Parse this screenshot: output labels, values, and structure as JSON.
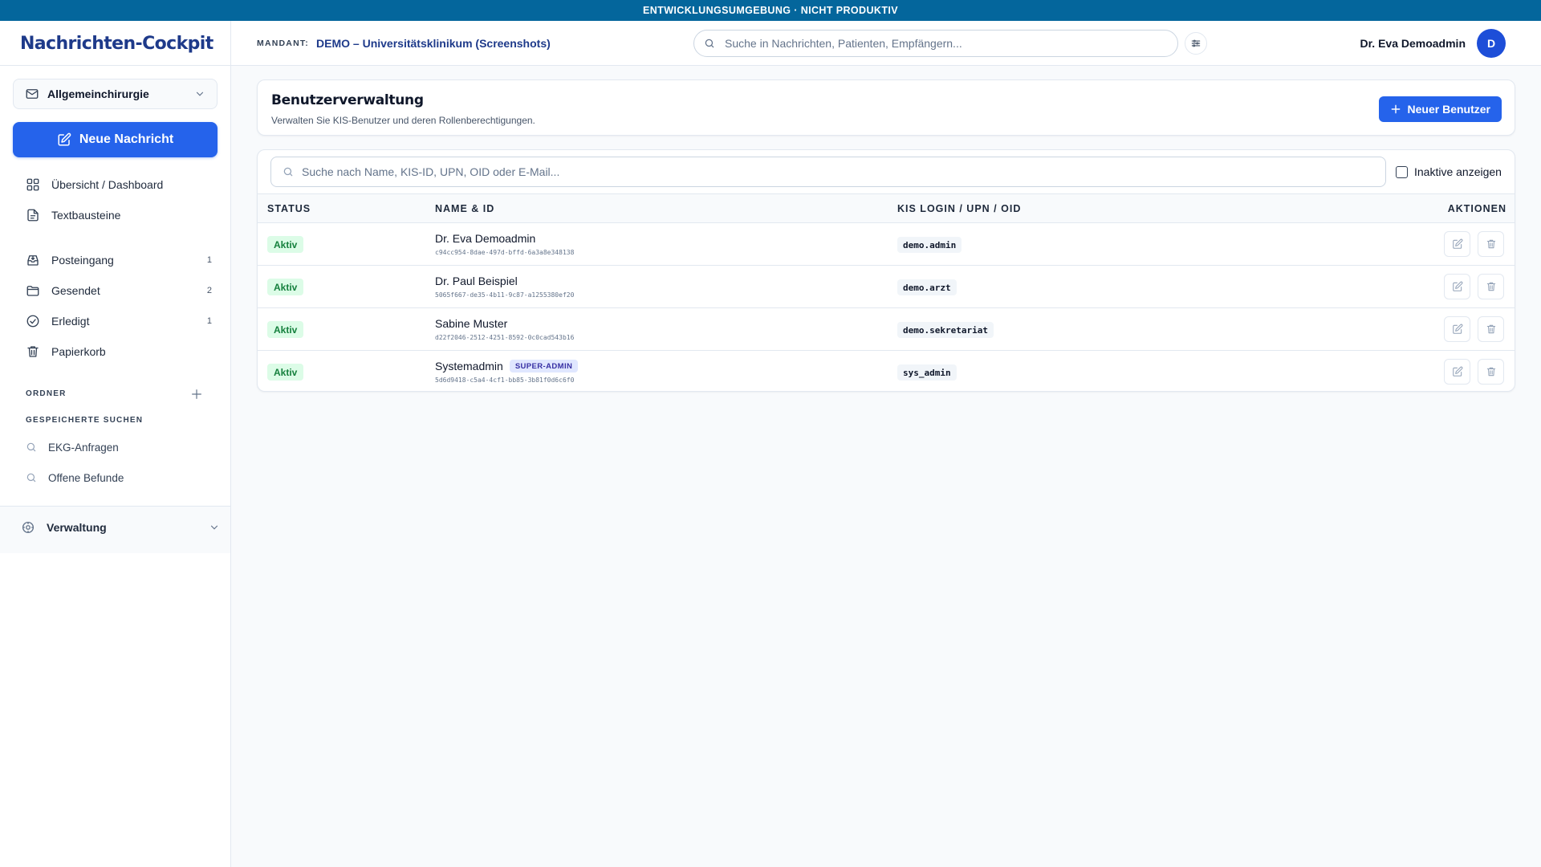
{
  "env_banner": "ENTWICKLUNGSUMGEBUNG · NICHT PRODUKTIV",
  "header": {
    "brand": "Nachrichten-Cockpit",
    "mandant_label": "MANDANT:",
    "mandant_value": "DEMO – Universitätsklinikum (Screenshots)",
    "search_placeholder": "Suche in Nachrichten, Patienten, Empfängern...",
    "user_name": "Dr. Eva Demoadmin",
    "avatar_initial": "D"
  },
  "sidebar": {
    "mailbox": "Allgemeinchirurgie",
    "new_message": "Neue Nachricht",
    "top_items": [
      {
        "label": "Übersicht / Dashboard",
        "icon": "dashboard-icon"
      },
      {
        "label": "Textbausteine",
        "icon": "document-icon"
      }
    ],
    "mail_items": [
      {
        "label": "Posteingang",
        "count": "1",
        "icon": "inbox-icon"
      },
      {
        "label": "Gesendet",
        "count": "2",
        "icon": "folder-icon"
      },
      {
        "label": "Erledigt",
        "count": "1",
        "icon": "check-circle-icon"
      },
      {
        "label": "Papierkorb",
        "count": "",
        "icon": "trash-icon"
      }
    ],
    "folders_label": "ORDNER",
    "saved_searches_label": "GESPEICHERTE SUCHEN",
    "saved_searches": [
      "EKG-Anfragen",
      "Offene Befunde"
    ],
    "admin_label": "Verwaltung"
  },
  "page": {
    "title": "Benutzerverwaltung",
    "subtitle": "Verwalten Sie KIS-Benutzer und deren Rollenberechtigungen.",
    "new_user_button": "Neuer Benutzer"
  },
  "table": {
    "search_placeholder": "Suche nach Name, KIS-ID, UPN, OID oder E-Mail...",
    "show_inactive_label": "Inaktive anzeigen",
    "show_inactive_checked": false,
    "columns": [
      "STATUS",
      "NAME & ID",
      "KIS LOGIN / UPN / OID",
      "AKTIONEN"
    ],
    "rows": [
      {
        "status": "Aktiv",
        "name": "Dr. Eva Demoadmin",
        "oid": "c94cc954-8dae-497d-bffd-6a3a8e348138",
        "login": "demo.admin",
        "badge": ""
      },
      {
        "status": "Aktiv",
        "name": "Dr. Paul Beispiel",
        "oid": "5065f667-de35-4b11-9c87-a1255380ef20",
        "login": "demo.arzt",
        "badge": ""
      },
      {
        "status": "Aktiv",
        "name": "Sabine Muster",
        "oid": "d22f2046-2512-4251-8592-0c0cad543b16",
        "login": "demo.sekretariat",
        "badge": ""
      },
      {
        "status": "Aktiv",
        "name": "Systemadmin",
        "oid": "5d6d9418-c5a4-4cf1-bb85-3b81f0d6c6f0",
        "login": "sys_admin",
        "badge": "SUPER-ADMIN"
      }
    ]
  },
  "colors": {
    "banner": "#04669c",
    "primary": "#2563eb",
    "brand": "#1e3a8a",
    "active_bg": "#dcfce7",
    "active_text": "#15803d",
    "super_admin_bg": "#e0e7ff",
    "super_admin_text": "#3730a3"
  }
}
